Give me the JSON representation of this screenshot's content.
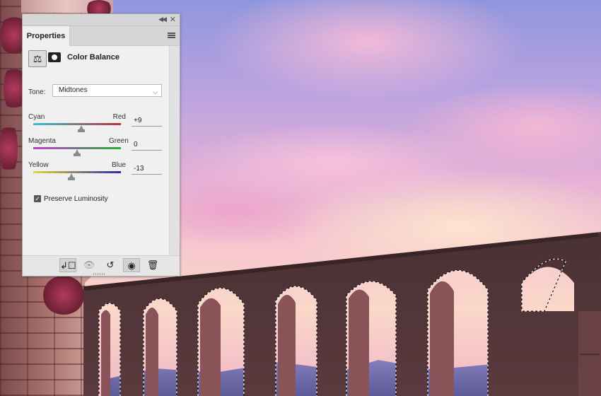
{
  "panel": {
    "tab_label": "Properties",
    "adjustment_title": "Color Balance",
    "tone": {
      "label": "Tone:",
      "value": "Midtones"
    },
    "sliders": [
      {
        "left": "Cyan",
        "right": "Red",
        "value": "+9",
        "level": 9
      },
      {
        "left": "Magenta",
        "right": "Green",
        "value": "0",
        "level": 0
      },
      {
        "left": "Yellow",
        "right": "Blue",
        "value": "-13",
        "level": -13
      }
    ],
    "preserve_luminosity": {
      "label": "Preserve Luminosity",
      "checked": true
    },
    "bottom_icons": [
      "clip-to-layer-icon",
      "view-previous-state-icon",
      "reset-icon",
      "visibility-eye-icon",
      "trash-icon"
    ]
  },
  "colors": {
    "panel_bg": "#f0f0f0",
    "cyan_red": [
      "#2fc3d6",
      "#c53030"
    ],
    "magenta_green": [
      "#c43ad0",
      "#22b030"
    ],
    "yellow_blue": [
      "#e6d82a",
      "#2a2ab0"
    ]
  }
}
